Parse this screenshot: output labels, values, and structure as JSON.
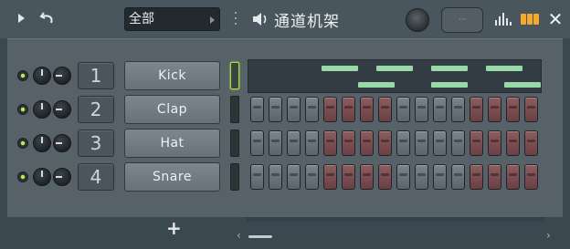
{
  "titlebar": {
    "filter_value": "全部",
    "title": "通道机架",
    "icons": {
      "play": "play-icon",
      "undo": "undo-icon",
      "grip": "grip-icon",
      "speaker": "speaker-icon",
      "graph": "graph-editor-icon",
      "piano": "piano-roll-icon",
      "close": "close-icon"
    },
    "close_glyph": "✕"
  },
  "channels": [
    {
      "number": "1",
      "name": "Kick",
      "selected": true,
      "view": "pianoroll"
    },
    {
      "number": "2",
      "name": "Clap",
      "selected": false,
      "view": "steps"
    },
    {
      "number": "3",
      "name": "Hat",
      "selected": false,
      "view": "steps"
    },
    {
      "number": "4",
      "name": "Snare",
      "selected": false,
      "view": "steps"
    }
  ],
  "step_groups": [
    "g",
    "g",
    "g",
    "g",
    "r",
    "r",
    "r",
    "r",
    "g",
    "g",
    "g",
    "g",
    "r",
    "r",
    "r",
    "r"
  ],
  "bottom": {
    "add_glyph": "+",
    "scroll_left_glyph": "‹",
    "scroll_right_glyph": "›"
  },
  "colors": {
    "led_on": "#b6ee4a",
    "note": "#99d9a7",
    "accent_orange": "#f3a92b"
  }
}
